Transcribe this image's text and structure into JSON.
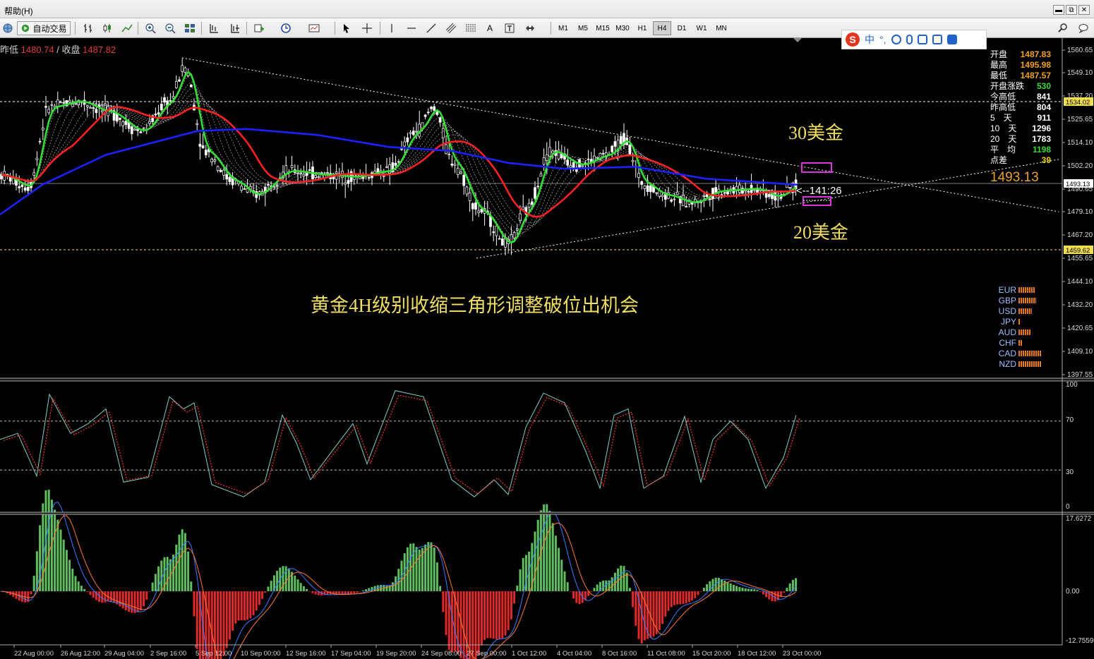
{
  "menubar": {
    "help": "帮助(H)"
  },
  "window_buttons": [
    "▬",
    "⧉",
    "✕"
  ],
  "toolbar": {
    "auto_trade": "自动交易",
    "timeframes": [
      "M1",
      "M5",
      "M15",
      "M30",
      "H1",
      "H4",
      "D1",
      "W1",
      "MN"
    ],
    "active_timeframe": "H4",
    "text_tool": "A"
  },
  "ime": {
    "lang": "中",
    "punct": "°,"
  },
  "header": {
    "prev_low_label": "昨低",
    "prev_low_value": "1480.74",
    "close_label": "/ 收盘",
    "close_value": "1487.82"
  },
  "stats": [
    {
      "label": "开盘",
      "value": "1487.83",
      "color": "#f0a020"
    },
    {
      "label": "最高",
      "value": "1495.98",
      "color": "#f0a020"
    },
    {
      "label": "最低",
      "value": "1487.57",
      "color": "#f0a020"
    },
    {
      "label": "开盘涨跌",
      "value": "530",
      "color": "#39d839"
    },
    {
      "label": "今高低",
      "value": "841",
      "color": "#ffffff"
    },
    {
      "label": "昨高低",
      "value": "804",
      "color": "#ffffff"
    },
    {
      "label": "5　天",
      "value": "911",
      "color": "#ffffff"
    },
    {
      "label": "10　天",
      "value": "1296",
      "color": "#ffffff"
    },
    {
      "label": "20　天",
      "value": "1783",
      "color": "#ffffff"
    },
    {
      "label": "平　均",
      "value": "1198",
      "color": "#39d839"
    },
    {
      "label": "点差",
      "value": "39",
      "color": "#f0d000"
    }
  ],
  "big_price": "1493.13",
  "countdown": "<--141:26",
  "annotations": {
    "upper": "30美金",
    "lower": "20美金",
    "title": "黄金4H级别收缩三角形调整破位出机会"
  },
  "currencies": [
    {
      "name": "EUR",
      "level": 0.55
    },
    {
      "name": "GBP",
      "level": 0.6
    },
    {
      "name": "USD",
      "level": 0.45
    },
    {
      "name": "JPY",
      "level": 0.08
    },
    {
      "name": "AUD",
      "level": 0.42
    },
    {
      "name": "CHF",
      "level": 0.12
    },
    {
      "name": "CAD",
      "level": 0.75
    },
    {
      "name": "NZD",
      "level": 0.75
    }
  ],
  "price_axis": {
    "labels": [
      "1560.65",
      "1549.10",
      "1537.20",
      "1525.65",
      "1514.10",
      "1502.20",
      "1490.65",
      "1479.10",
      "1467.20",
      "1455.65",
      "1444.10",
      "1432.20",
      "1420.65",
      "1409.10",
      "1397.55"
    ],
    "marker_upper": "1534.02",
    "marker_current": "1493.13",
    "marker_lower": "1459.62"
  },
  "stoch_axis": [
    "100",
    "70",
    "30",
    "0"
  ],
  "macd_axis": [
    "17.6272",
    "0.00",
    "-12.7559"
  ],
  "time_axis": [
    "22 Aug 00:00",
    "26 Aug 12:00",
    "29 Aug 04:00",
    "2 Sep 16:00",
    "5 Sep 12:00",
    "10 Sep 00:00",
    "12 Sep 16:00",
    "17 Sep 04:00",
    "19 Sep 20:00",
    "24 Sep 08:00",
    "27 Sep 00:00",
    "1 Oct 12:00",
    "4 Oct 04:00",
    "8 Oct 16:00",
    "11 Oct 08:00",
    "15 Oct 20:00",
    "18 Oct 12:00",
    "23 Oct 00:00"
  ],
  "colors": {
    "ma_green": "#33dd33",
    "ma_red": "#ff2222",
    "ma_blue": "#1a22ff",
    "candle": "#ffffff",
    "annotation": "#f0dd63",
    "box": "#dd33dd",
    "macd_up": "#5fbf5f",
    "macd_down": "#e02a2a"
  }
}
